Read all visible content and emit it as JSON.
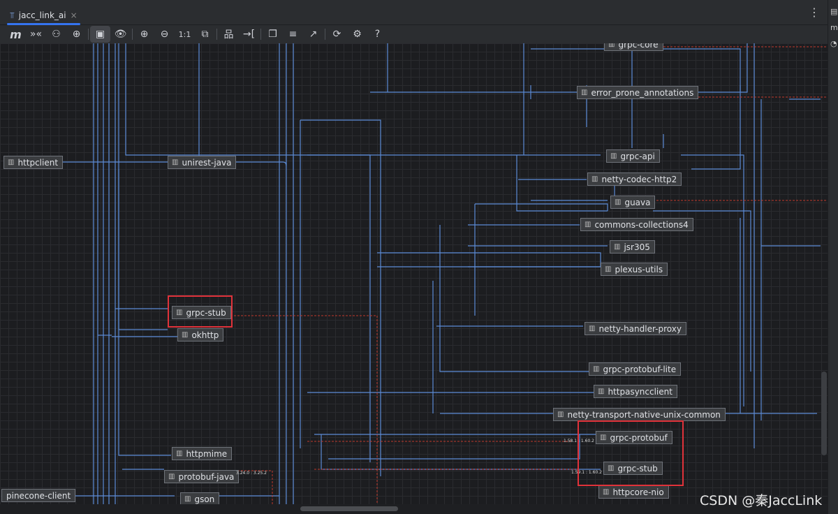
{
  "tab": {
    "title": "jacc_link_ai",
    "close": "×",
    "icon": "diagram-icon"
  },
  "menu_icon": "⋮",
  "toolbar": [
    {
      "name": "maven-icon",
      "glyph": "m"
    },
    {
      "name": "show-conflicts-icon",
      "glyph": "»«"
    },
    {
      "name": "show-dependencies-icon",
      "glyph": "⚇"
    },
    {
      "name": "find-icon",
      "glyph": "⊕"
    },
    {
      "name": "fit-content-icon",
      "glyph": "▣",
      "active": true
    },
    {
      "name": "view-options-icon",
      "glyph": "👁"
    },
    {
      "name": "zoom-in-icon",
      "glyph": "⊕"
    },
    {
      "name": "zoom-out-icon",
      "glyph": "⊖"
    },
    {
      "name": "actual-size-icon",
      "glyph": "1:1"
    },
    {
      "name": "fit-page-icon",
      "glyph": "⧉"
    },
    {
      "name": "layout-icon",
      "glyph": "品"
    },
    {
      "name": "route-edges-icon",
      "glyph": "→["
    },
    {
      "name": "copy-icon",
      "glyph": "❐"
    },
    {
      "name": "export-text-icon",
      "glyph": "≡"
    },
    {
      "name": "export-icon",
      "glyph": "↗"
    },
    {
      "name": "refresh-icon",
      "glyph": "⟳"
    },
    {
      "name": "settings-icon",
      "glyph": "⚙"
    },
    {
      "name": "help-icon",
      "glyph": "?"
    }
  ],
  "nodes": [
    "grpc-core",
    "error_prone_annotations",
    "httpclient",
    "unirest-java",
    "grpc-api",
    "netty-codec-http2",
    "guava",
    "commons-collections4",
    "jsr305",
    "plexus-utils",
    "grpc-stub",
    "okhttp",
    "netty-handler-proxy",
    "grpc-protobuf-lite",
    "httpasyncclient",
    "netty-transport-native-unix-common",
    "grpc-protobuf",
    "httpmime",
    "grpc-stub",
    "protobuf-java",
    "pinecone-client",
    "gson",
    "httpcore-nio"
  ],
  "edge_labels": [
    "1.58.1 : 1.60.2",
    "1.59.1 : 1.60.2",
    "3.24.0 : 3.25.2"
  ],
  "watermark": "CSDN @秦JaccLink",
  "colors": {
    "edge": "#5b8bd6",
    "conflict": "#c0392b",
    "highlight": "#e0323a"
  }
}
